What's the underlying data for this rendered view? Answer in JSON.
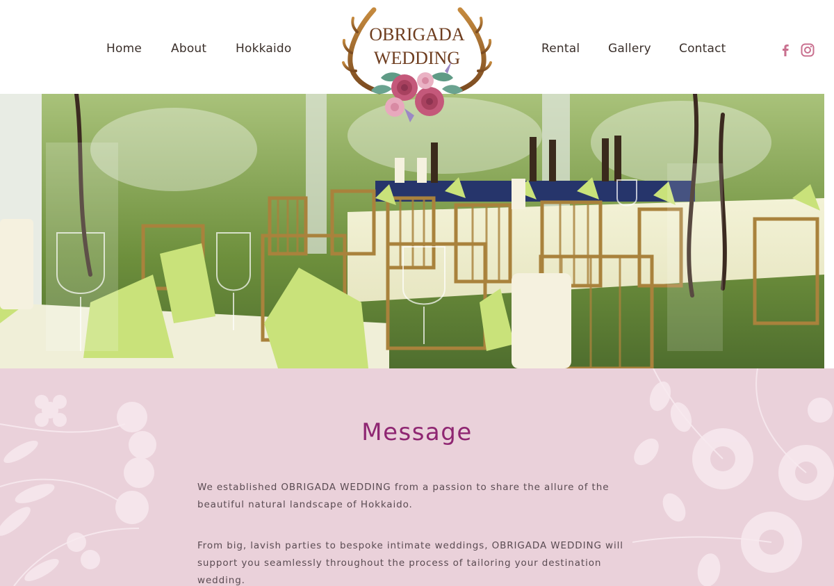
{
  "nav": {
    "left": [
      "Home",
      "About",
      "Hokkaido"
    ],
    "right": [
      "Rental",
      "Gallery",
      "Contact"
    ]
  },
  "logo": {
    "line1": "OBRIGADA",
    "line2": "WEDDING"
  },
  "social": {
    "icons": [
      "facebook-icon",
      "instagram-icon"
    ],
    "color": "#c9708f"
  },
  "message": {
    "title": "Message",
    "paragraphs": [
      "We established OBRIGADA WEDDING from a passion to share the allure of the beautiful natural landscape of Hokkaido.",
      "From big, lavish parties to bespoke intimate weddings, OBRIGADA WEDDING will support you seamlessly throughout the process of tailoring your destination wedding."
    ]
  },
  "colors": {
    "title": "#8f2672",
    "section_bg": "#ead1da",
    "nav_text": "#3a2f2a"
  }
}
